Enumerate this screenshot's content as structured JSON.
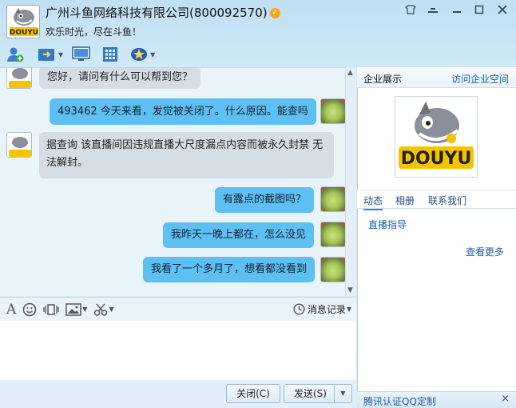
{
  "header": {
    "title": "广州斗鱼网络科技有限公司(800092570)",
    "subtitle": "欢乐时光，尽在斗鱼！",
    "verified_icon": "verified-badge-icon"
  },
  "window_controls": {
    "skin": "▾",
    "minimize": "—",
    "maximize": "□",
    "close": "✕"
  },
  "toolbar": {
    "icons": [
      "add-contact-icon",
      "transfer-file-icon",
      "remote-desktop-icon",
      "app-grid-icon",
      "enterprise-service-icon"
    ]
  },
  "messages": [
    {
      "from": "company",
      "text": "您好，请问有什么可以帮到您？"
    },
    {
      "from": "user",
      "text": "493462 今天来看，发觉被关闭了。什么原因。能查吗"
    },
    {
      "from": "company",
      "text": "据查询 该直播间因违规直播大尺度漏点内容而被永久封禁 无",
      "text2": "法解封。"
    },
    {
      "from": "user",
      "text": "有露点的截图吗？"
    },
    {
      "from": "user",
      "text": "我昨天一晚上都在，怎么没见"
    },
    {
      "from": "user",
      "text": "我看了一个多月了，想看都没看到"
    }
  ],
  "input_toolbar": {
    "font": "A",
    "history_label": "消息记录"
  },
  "buttons": {
    "close": "关闭(C)",
    "send": "发送(S)"
  },
  "right_panel": {
    "title": "企业展示",
    "visit_link": "访问企业空间",
    "tabs": [
      "动态",
      "相册",
      "联系我们"
    ],
    "live_guide": "直播指导",
    "more": "查看更多",
    "footer": "腾讯认证QQ定制",
    "footer_close": "×"
  },
  "brand": {
    "logo_text": "DOUYU",
    "accent": "#5ebff2",
    "logo_yellow": "#f5c400"
  }
}
